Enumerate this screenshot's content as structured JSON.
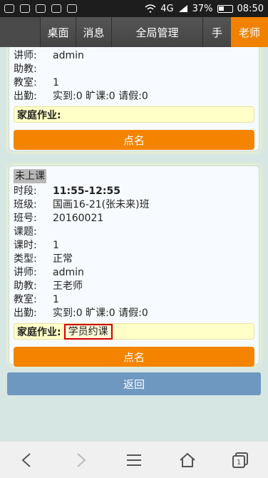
{
  "status_bar": {
    "signal": "4G",
    "battery": "37%",
    "time": "08:50"
  },
  "nav": {
    "desk": "桌面",
    "messages": "消息",
    "global_manage": "全局管理",
    "hand": "手",
    "teacher": "老师"
  },
  "card1": {
    "rows": [
      {
        "k": "讲师:",
        "v": "admin"
      },
      {
        "k": "助教:",
        "v": ""
      },
      {
        "k": "教室:",
        "v": "1"
      },
      {
        "k": "出勤:",
        "v": "实到:0 旷课:0 请假:0"
      }
    ],
    "homework_label": "家庭作业:",
    "button": "点名"
  },
  "card2": {
    "status": "未上课",
    "time_label": "时段:",
    "time_value": "11:55-12:55",
    "rows": [
      {
        "k": "班级:",
        "v": "国画16-21(张未来)班"
      },
      {
        "k": "班号:",
        "v": "20160021"
      },
      {
        "k": "课题:",
        "v": ""
      },
      {
        "k": "课时:",
        "v": "1"
      },
      {
        "k": "类型:",
        "v": "正常"
      },
      {
        "k": "讲师:",
        "v": "admin"
      },
      {
        "k": "助教:",
        "v": "王老师"
      },
      {
        "k": "教室:",
        "v": "1"
      },
      {
        "k": "出勤:",
        "v": "实到:0 旷课:0 请假:0"
      }
    ],
    "homework_label": "家庭作业:",
    "homework_value": "学员约课",
    "button": "点名"
  },
  "back": "返回",
  "bottom": {
    "tabs_count": "1"
  }
}
